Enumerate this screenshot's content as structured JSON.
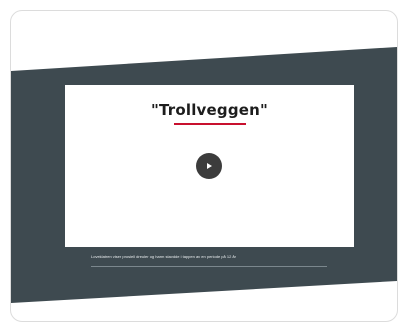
{
  "video": {
    "title": "\"Trollveggen\"",
    "caption": "Loveklatren viser prosiell dreuler og harm stavdde i tappen av en periode på 12 år",
    "play_icon": "play-icon"
  },
  "colors": {
    "band": "#3e4a50",
    "accent": "#c8102e",
    "play_button": "#3c3c3c"
  }
}
